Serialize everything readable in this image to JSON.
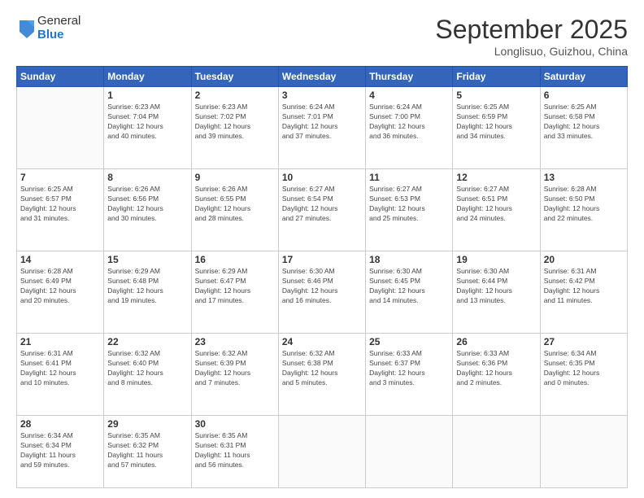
{
  "logo": {
    "general": "General",
    "blue": "Blue"
  },
  "header": {
    "month": "September 2025",
    "location": "Longlisuo, Guizhou, China"
  },
  "weekdays": [
    "Sunday",
    "Monday",
    "Tuesday",
    "Wednesday",
    "Thursday",
    "Friday",
    "Saturday"
  ],
  "weeks": [
    [
      {
        "day": "",
        "info": ""
      },
      {
        "day": "1",
        "info": "Sunrise: 6:23 AM\nSunset: 7:04 PM\nDaylight: 12 hours\nand 40 minutes."
      },
      {
        "day": "2",
        "info": "Sunrise: 6:23 AM\nSunset: 7:02 PM\nDaylight: 12 hours\nand 39 minutes."
      },
      {
        "day": "3",
        "info": "Sunrise: 6:24 AM\nSunset: 7:01 PM\nDaylight: 12 hours\nand 37 minutes."
      },
      {
        "day": "4",
        "info": "Sunrise: 6:24 AM\nSunset: 7:00 PM\nDaylight: 12 hours\nand 36 minutes."
      },
      {
        "day": "5",
        "info": "Sunrise: 6:25 AM\nSunset: 6:59 PM\nDaylight: 12 hours\nand 34 minutes."
      },
      {
        "day": "6",
        "info": "Sunrise: 6:25 AM\nSunset: 6:58 PM\nDaylight: 12 hours\nand 33 minutes."
      }
    ],
    [
      {
        "day": "7",
        "info": "Sunrise: 6:25 AM\nSunset: 6:57 PM\nDaylight: 12 hours\nand 31 minutes."
      },
      {
        "day": "8",
        "info": "Sunrise: 6:26 AM\nSunset: 6:56 PM\nDaylight: 12 hours\nand 30 minutes."
      },
      {
        "day": "9",
        "info": "Sunrise: 6:26 AM\nSunset: 6:55 PM\nDaylight: 12 hours\nand 28 minutes."
      },
      {
        "day": "10",
        "info": "Sunrise: 6:27 AM\nSunset: 6:54 PM\nDaylight: 12 hours\nand 27 minutes."
      },
      {
        "day": "11",
        "info": "Sunrise: 6:27 AM\nSunset: 6:53 PM\nDaylight: 12 hours\nand 25 minutes."
      },
      {
        "day": "12",
        "info": "Sunrise: 6:27 AM\nSunset: 6:51 PM\nDaylight: 12 hours\nand 24 minutes."
      },
      {
        "day": "13",
        "info": "Sunrise: 6:28 AM\nSunset: 6:50 PM\nDaylight: 12 hours\nand 22 minutes."
      }
    ],
    [
      {
        "day": "14",
        "info": "Sunrise: 6:28 AM\nSunset: 6:49 PM\nDaylight: 12 hours\nand 20 minutes."
      },
      {
        "day": "15",
        "info": "Sunrise: 6:29 AM\nSunset: 6:48 PM\nDaylight: 12 hours\nand 19 minutes."
      },
      {
        "day": "16",
        "info": "Sunrise: 6:29 AM\nSunset: 6:47 PM\nDaylight: 12 hours\nand 17 minutes."
      },
      {
        "day": "17",
        "info": "Sunrise: 6:30 AM\nSunset: 6:46 PM\nDaylight: 12 hours\nand 16 minutes."
      },
      {
        "day": "18",
        "info": "Sunrise: 6:30 AM\nSunset: 6:45 PM\nDaylight: 12 hours\nand 14 minutes."
      },
      {
        "day": "19",
        "info": "Sunrise: 6:30 AM\nSunset: 6:44 PM\nDaylight: 12 hours\nand 13 minutes."
      },
      {
        "day": "20",
        "info": "Sunrise: 6:31 AM\nSunset: 6:42 PM\nDaylight: 12 hours\nand 11 minutes."
      }
    ],
    [
      {
        "day": "21",
        "info": "Sunrise: 6:31 AM\nSunset: 6:41 PM\nDaylight: 12 hours\nand 10 minutes."
      },
      {
        "day": "22",
        "info": "Sunrise: 6:32 AM\nSunset: 6:40 PM\nDaylight: 12 hours\nand 8 minutes."
      },
      {
        "day": "23",
        "info": "Sunrise: 6:32 AM\nSunset: 6:39 PM\nDaylight: 12 hours\nand 7 minutes."
      },
      {
        "day": "24",
        "info": "Sunrise: 6:32 AM\nSunset: 6:38 PM\nDaylight: 12 hours\nand 5 minutes."
      },
      {
        "day": "25",
        "info": "Sunrise: 6:33 AM\nSunset: 6:37 PM\nDaylight: 12 hours\nand 3 minutes."
      },
      {
        "day": "26",
        "info": "Sunrise: 6:33 AM\nSunset: 6:36 PM\nDaylight: 12 hours\nand 2 minutes."
      },
      {
        "day": "27",
        "info": "Sunrise: 6:34 AM\nSunset: 6:35 PM\nDaylight: 12 hours\nand 0 minutes."
      }
    ],
    [
      {
        "day": "28",
        "info": "Sunrise: 6:34 AM\nSunset: 6:34 PM\nDaylight: 11 hours\nand 59 minutes."
      },
      {
        "day": "29",
        "info": "Sunrise: 6:35 AM\nSunset: 6:32 PM\nDaylight: 11 hours\nand 57 minutes."
      },
      {
        "day": "30",
        "info": "Sunrise: 6:35 AM\nSunset: 6:31 PM\nDaylight: 11 hours\nand 56 minutes."
      },
      {
        "day": "",
        "info": ""
      },
      {
        "day": "",
        "info": ""
      },
      {
        "day": "",
        "info": ""
      },
      {
        "day": "",
        "info": ""
      }
    ]
  ]
}
